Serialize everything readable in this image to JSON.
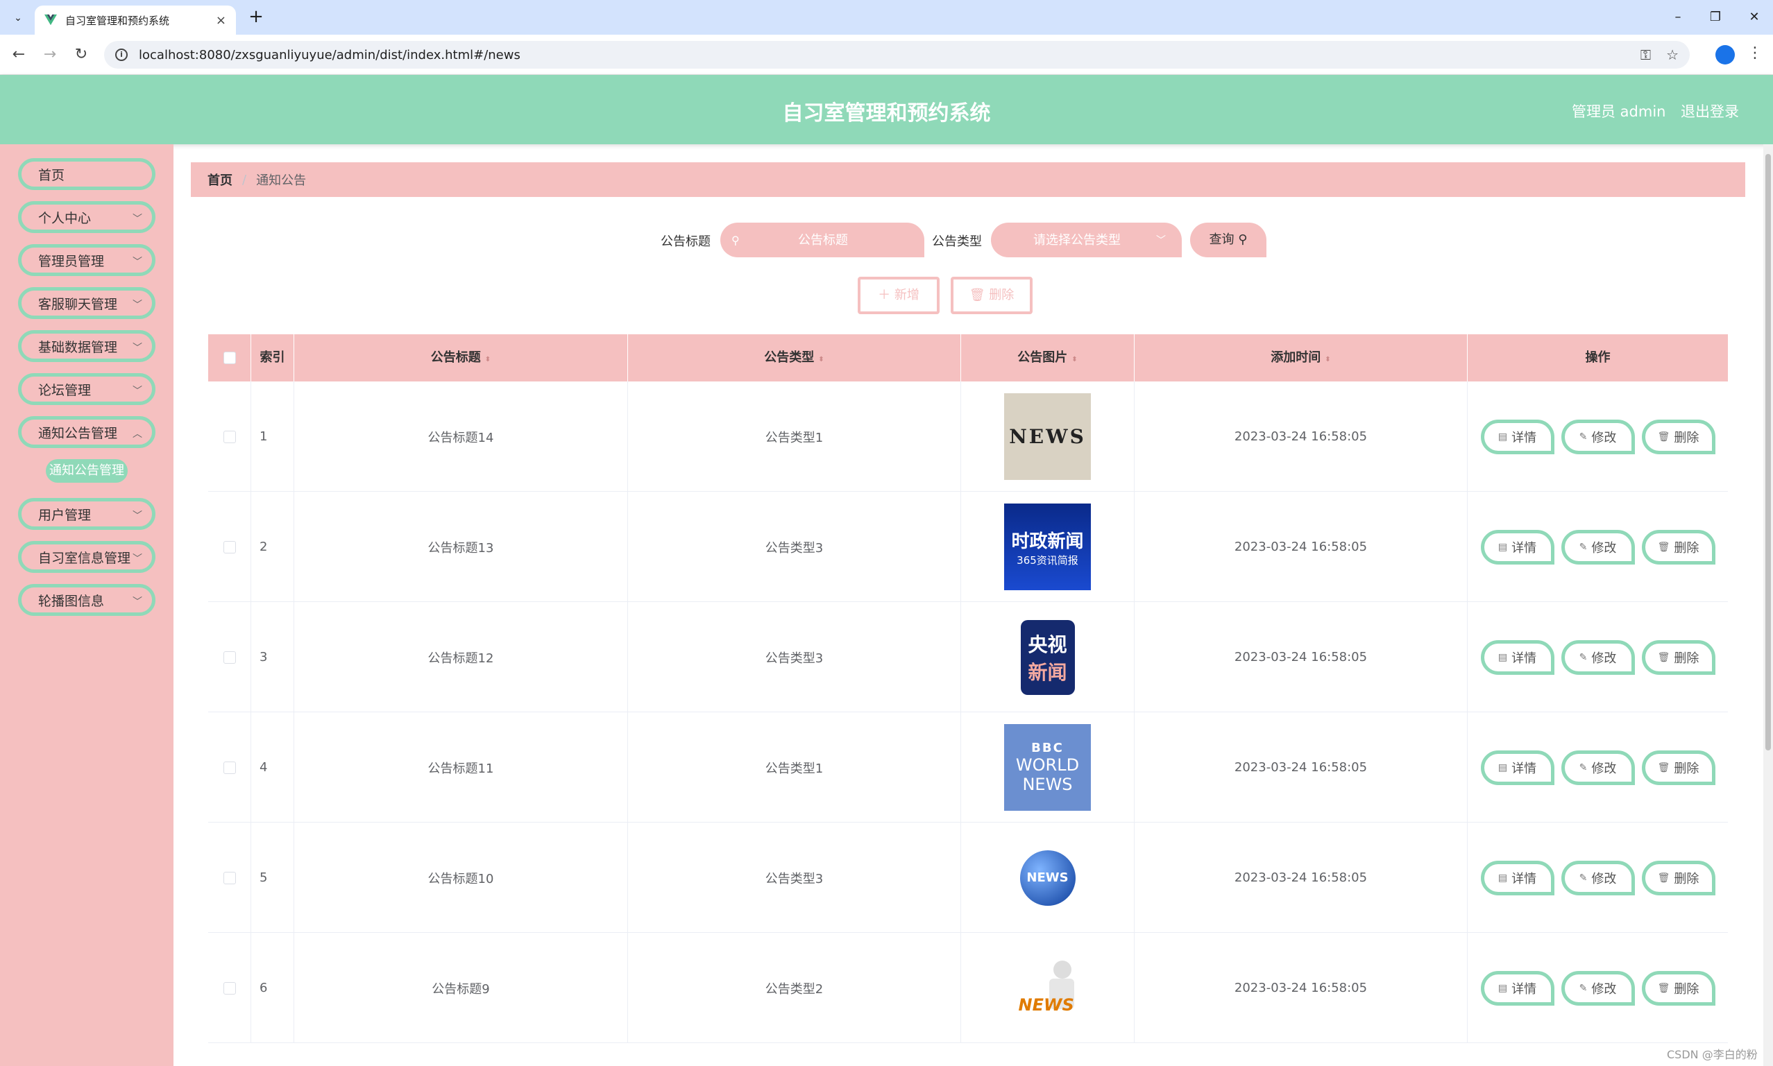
{
  "browser": {
    "tab_title": "自习室管理和预约系统",
    "url": "localhost:8080/zxsguanliyuyue/admin/dist/index.html#/news"
  },
  "header": {
    "title": "自习室管理和预约系统",
    "user": "管理员 admin",
    "logout": "退出登录"
  },
  "sidebar": {
    "items": [
      {
        "label": "首页"
      },
      {
        "label": "个人中心"
      },
      {
        "label": "管理员管理"
      },
      {
        "label": "客服聊天管理"
      },
      {
        "label": "基础数据管理"
      },
      {
        "label": "论坛管理"
      },
      {
        "label": "通知公告管理"
      },
      {
        "label": "用户管理"
      },
      {
        "label": "自习室信息管理"
      },
      {
        "label": "轮播图信息"
      }
    ],
    "active_submenu": "通知公告管理"
  },
  "breadcrumb": {
    "home": "首页",
    "current": "通知公告"
  },
  "search": {
    "title_label": "公告标题",
    "title_placeholder": "公告标题",
    "type_label": "公告类型",
    "type_placeholder": "请选择公告类型",
    "query_label": "查询"
  },
  "actions": {
    "add": "新增",
    "delete": "删除"
  },
  "table": {
    "headers": {
      "index": "索引",
      "title": "公告标题",
      "type": "公告类型",
      "image": "公告图片",
      "time": "添加时间",
      "ops": "操作"
    },
    "op_labels": {
      "detail": "详情",
      "edit": "修改",
      "delete": "删除"
    },
    "rows": [
      {
        "index": "1",
        "title": "公告标题14",
        "type": "公告类型1",
        "image": "NEWS",
        "time": "2023-03-24 16:58:05"
      },
      {
        "index": "2",
        "title": "公告标题13",
        "type": "公告类型3",
        "image": "时政新闻",
        "image_sub": "365资讯简报",
        "time": "2023-03-24 16:58:05"
      },
      {
        "index": "3",
        "title": "公告标题12",
        "type": "公告类型3",
        "image": "央视",
        "image_sub": "新闻",
        "time": "2023-03-24 16:58:05"
      },
      {
        "index": "4",
        "title": "公告标题11",
        "type": "公告类型1",
        "image": "BBC",
        "image_sub": "WORLD NEWS",
        "time": "2023-03-24 16:58:05"
      },
      {
        "index": "5",
        "title": "公告标题10",
        "type": "公告类型3",
        "image": "NEWS",
        "time": "2023-03-24 16:58:05"
      },
      {
        "index": "6",
        "title": "公告标题9",
        "type": "公告类型2",
        "image": "NEWS",
        "time": "2023-03-24 16:58:05"
      }
    ]
  },
  "watermark": "CSDN @李白的粉",
  "colors": {
    "header_bg": "#8fd9b8",
    "sidebar_bg": "#f5c0c0",
    "accent_border": "#8fd9b8"
  }
}
